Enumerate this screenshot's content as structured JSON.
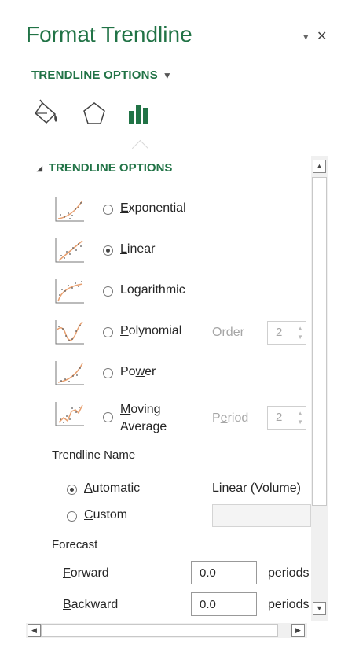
{
  "pane": {
    "title": "Format Trendline",
    "header_controls": {
      "dropdown_glyph": "▾",
      "close_glyph": "✕"
    },
    "options_dropdown_label": "TRENDLINE OPTIONS",
    "tabs": [
      {
        "name": "fill-line",
        "icon": "paint-bucket-icon"
      },
      {
        "name": "effects",
        "icon": "pentagon-icon"
      },
      {
        "name": "trendline-options",
        "icon": "bar-chart-icon",
        "active": true
      }
    ]
  },
  "section": {
    "title": "TRENDLINE OPTIONS",
    "types": [
      {
        "id": "exponential",
        "pre": "",
        "ul": "E",
        "post": "xponential",
        "selected": false
      },
      {
        "id": "linear",
        "pre": "",
        "ul": "L",
        "post": "inear",
        "selected": true
      },
      {
        "id": "logarithmic",
        "pre": "Lo",
        "ul": "g",
        "post": "arithmic",
        "selected": false
      },
      {
        "id": "polynomial",
        "pre": "",
        "ul": "P",
        "post": "olynomial",
        "selected": false
      },
      {
        "id": "power",
        "pre": "Po",
        "ul": "w",
        "post": "er",
        "selected": false
      },
      {
        "id": "moving-average",
        "pre": "",
        "ul": "M",
        "post": "oving",
        "line2": "Average",
        "selected": false
      }
    ],
    "order": {
      "pre": "Or",
      "ul": "d",
      "post": "er",
      "value": "2"
    },
    "period": {
      "pre": "P",
      "ul": "e",
      "post": "riod",
      "value": "2"
    },
    "trendline_name": {
      "label": "Trendline Name",
      "automatic": {
        "ul": "A",
        "post": "utomatic",
        "selected": true,
        "value": "Linear (Volume)"
      },
      "custom": {
        "ul": "C",
        "post": "ustom",
        "selected": false,
        "value": ""
      }
    },
    "forecast": {
      "label": "Forecast",
      "forward": {
        "ul": "F",
        "post": "orward",
        "value": "0.0",
        "unit": "periods"
      },
      "backward": {
        "ul": "B",
        "post": "ackward",
        "value": "0.0",
        "unit": "periods"
      }
    }
  },
  "colors": {
    "accent": "#217346",
    "trend_line": "#e8a070",
    "text": "#262626",
    "disabled": "#a6a6a6"
  }
}
